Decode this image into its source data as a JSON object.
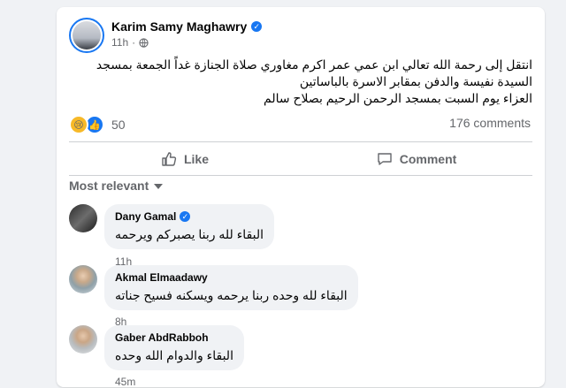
{
  "post": {
    "author": "Karim Samy Maghawry",
    "time": "11h",
    "text_lines": [
      "انتقل إلى رحمة الله تعالي ابن عمي عمر اكرم مغاوري صلاة الجنازة غداً الجمعة بمسجد",
      "السيدة نفيسة والدفن بمقابر الاسرة بالباساتين",
      "العزاء يوم السبت بمسجد الرحمن الرحيم بصلاح سالم"
    ],
    "reaction_count": "50",
    "comments_count": "176 comments"
  },
  "actions": {
    "like": "Like",
    "comment": "Comment"
  },
  "sort": {
    "label": "Most relevant"
  },
  "comments": [
    {
      "name": "Dany Gamal",
      "verified": true,
      "text": "البقاء لله ربنا يصبركم ويرحمه",
      "time": "11h"
    },
    {
      "name": "Akmal Elmaadawy",
      "verified": false,
      "text": "البقاء لله وحده ربنا يرحمه ويسكنه فسيح جناته",
      "time": "8h"
    },
    {
      "name": "Gaber AbdRabboh",
      "verified": false,
      "text": "البقاء والدوام الله وحده",
      "time": "45m"
    }
  ],
  "colors": {
    "accent": "#1877f2",
    "muted": "#65676b",
    "bubble": "#f0f2f5",
    "background": "#f0f2f5"
  }
}
